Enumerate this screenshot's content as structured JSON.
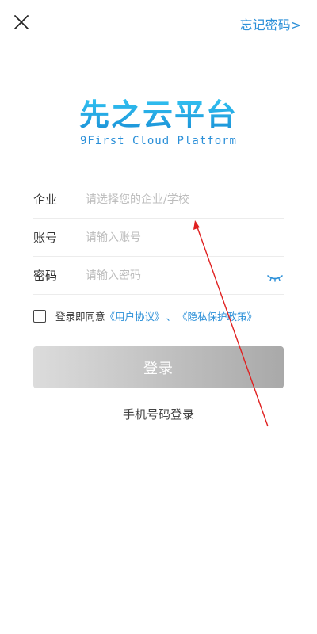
{
  "header": {
    "close_icon": "close-icon",
    "forgot_password_label": "忘记密码>"
  },
  "logo": {
    "title": "先之云平台",
    "subtitle": "9First Cloud Platform"
  },
  "form": {
    "company": {
      "label": "企业",
      "placeholder": "请选择您的企业/学校"
    },
    "account": {
      "label": "账号",
      "placeholder": "请输入账号"
    },
    "password": {
      "label": "密码",
      "placeholder": "请输入密码",
      "toggle_icon": "eye-closed-icon"
    }
  },
  "agreement": {
    "checked": false,
    "prefix": "登录即同意",
    "user_agreement": "《用户协议》",
    "separator": "、",
    "privacy_policy": "《隐私保护政策》"
  },
  "login_button_label": "登录",
  "phone_login_label": "手机号码登录",
  "colors": {
    "accent": "#2a8fd8",
    "logo": "#1cb0e6",
    "annotation_arrow": "#e02020"
  }
}
